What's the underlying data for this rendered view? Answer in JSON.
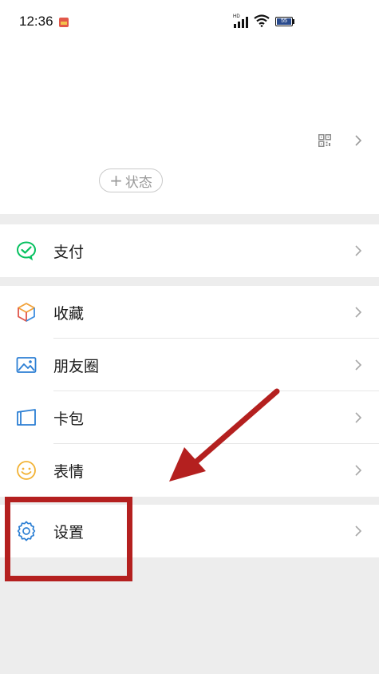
{
  "status_bar": {
    "time": "12:36",
    "network_type": "HD",
    "battery_level": "55"
  },
  "profile": {
    "status_button": "状态",
    "status_plus": "+"
  },
  "menu": {
    "pay": "支付",
    "favorites": "收藏",
    "moments": "朋友圈",
    "cards": "卡包",
    "stickers": "表情",
    "settings": "设置"
  },
  "colors": {
    "accent_green": "#07c160",
    "annotation_red": "#b4201f",
    "blue_icon": "#2c7fd4"
  }
}
